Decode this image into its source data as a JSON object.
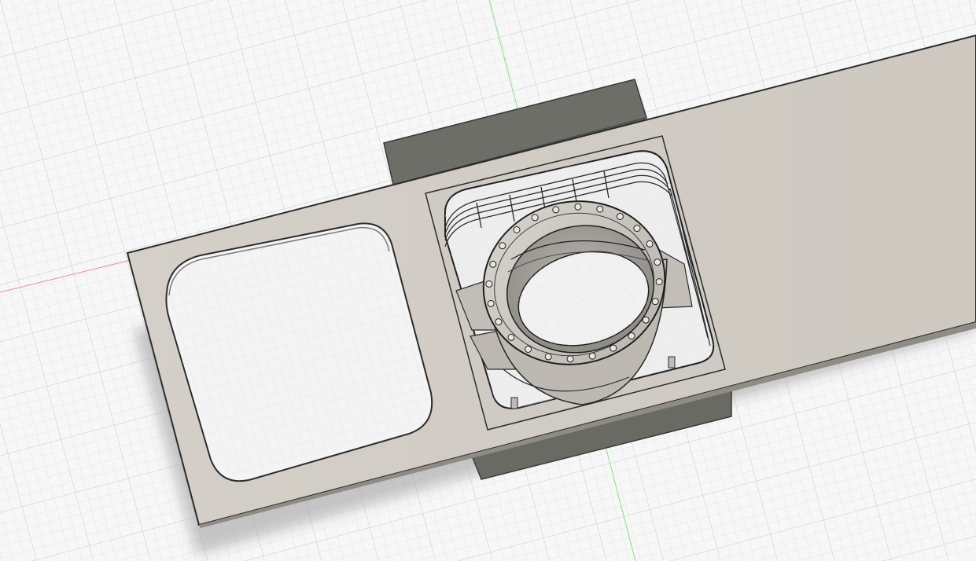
{
  "viewport": {
    "background": "#f7f7f7",
    "grid_color": "#d9d9d9",
    "grid_minor_color": "#e6e6e6",
    "x_axis_color": "#f08a8a",
    "y_axis_color": "#88dd88"
  },
  "model": {
    "plate_color": "#d2cdc5",
    "plate_edge": "#2c2c2c",
    "shadow_color": "#b9b9b9",
    "side_dark": "#6c6c66",
    "side_darker": "#5a5a55",
    "ring_color": "#c9c5be",
    "ring_inner": "#a9a6a0",
    "hole_count": 24
  }
}
